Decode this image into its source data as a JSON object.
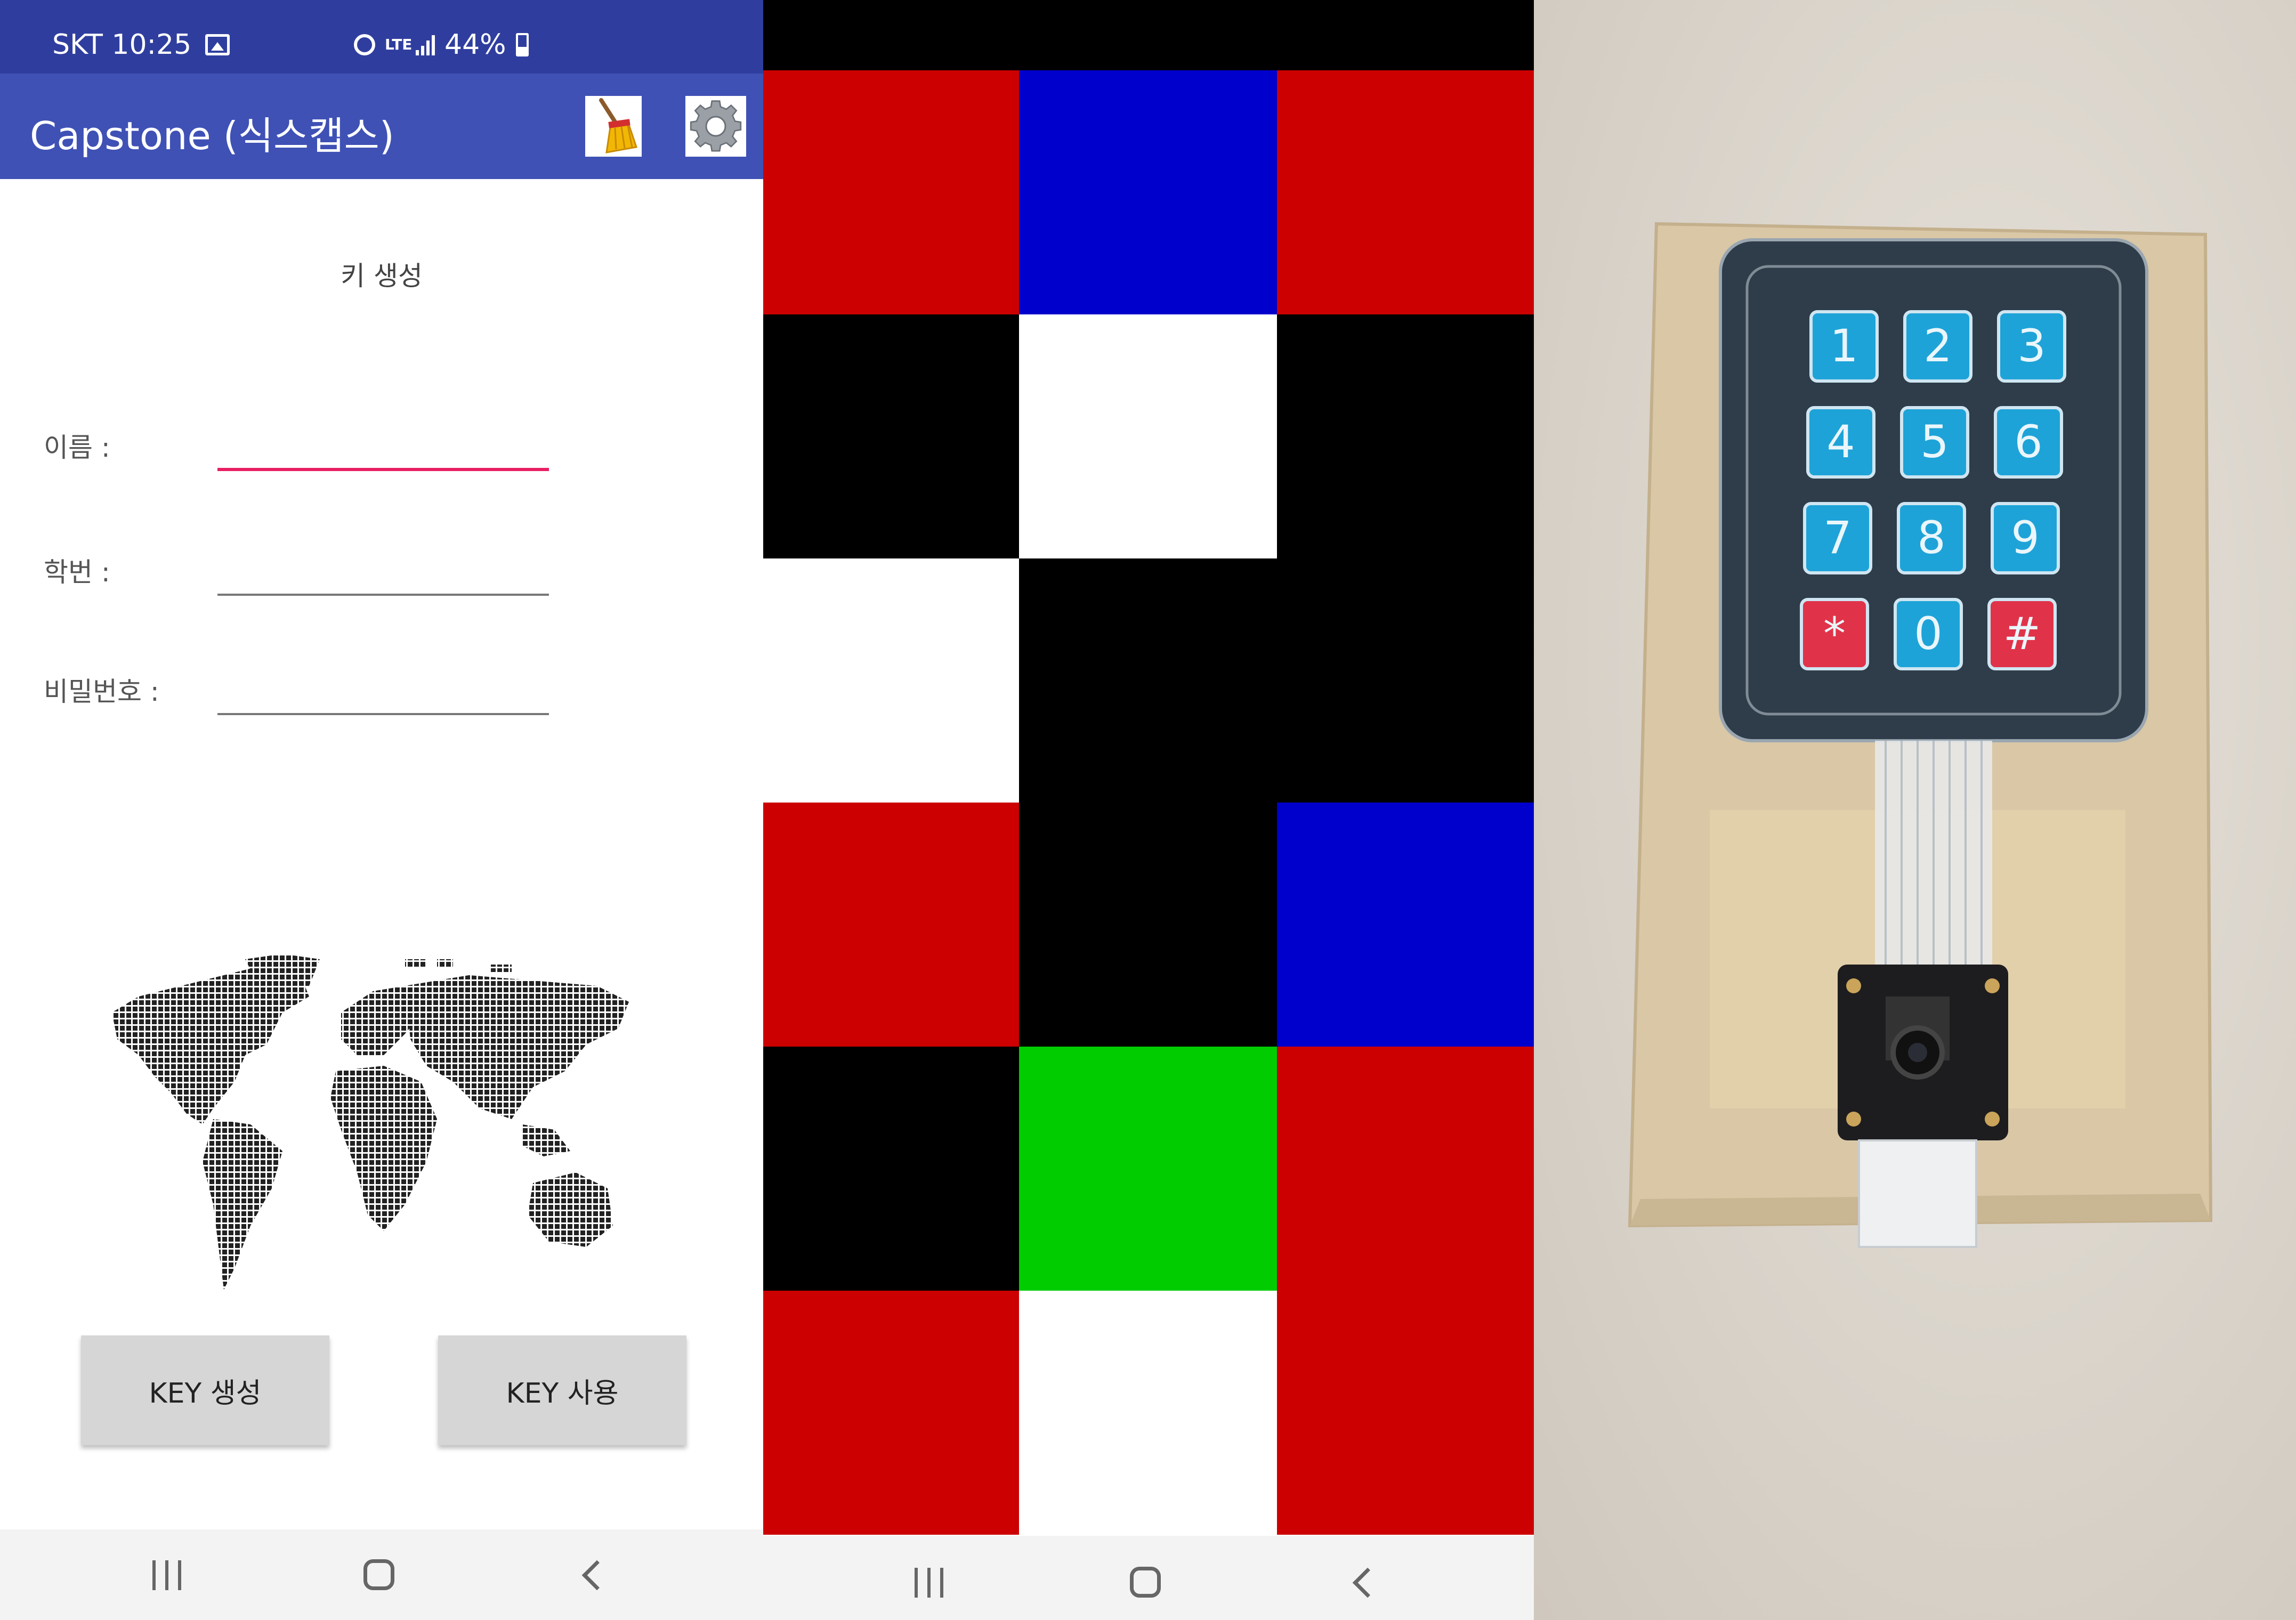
{
  "status_bar": {
    "carrier_time": "SKT 10:25",
    "network": "LTE",
    "battery": "44%"
  },
  "app_bar": {
    "title": "Capstone (식스캡스)",
    "clear_icon": "broom-icon",
    "settings_icon": "gear-icon",
    "color": "#3f51b5",
    "status_color": "#2f3e9e"
  },
  "page": {
    "heading": "키 생성",
    "name_label": "이름 :",
    "student_id_label": "학번 :",
    "password_label": "비밀번호 :",
    "name_value": "",
    "student_id_value": "",
    "password_value": "",
    "map_icon": "world-map-icon"
  },
  "buttons": {
    "create": "KEY 생성",
    "use": "KEY 사용"
  },
  "color_grid": {
    "rows": [
      [
        "red",
        "blue",
        "red"
      ],
      [
        "black",
        "white",
        "black"
      ],
      [
        "white",
        "black",
        "black"
      ],
      [
        "red",
        "black",
        "blue"
      ],
      [
        "black",
        "green",
        "red"
      ],
      [
        "red",
        "white",
        "red"
      ]
    ],
    "palette": {
      "red": "#cc0000",
      "blue": "#0000cc",
      "black": "#000000",
      "white": "#ffffff",
      "green": "#00cc00"
    }
  },
  "photo": {
    "keypad_keys": [
      "1",
      "2",
      "3",
      "4",
      "5",
      "6",
      "7",
      "8",
      "9",
      "*",
      "0",
      "#"
    ],
    "key_color": "#1ea3d8",
    "special_key_color": "#e0334a"
  }
}
